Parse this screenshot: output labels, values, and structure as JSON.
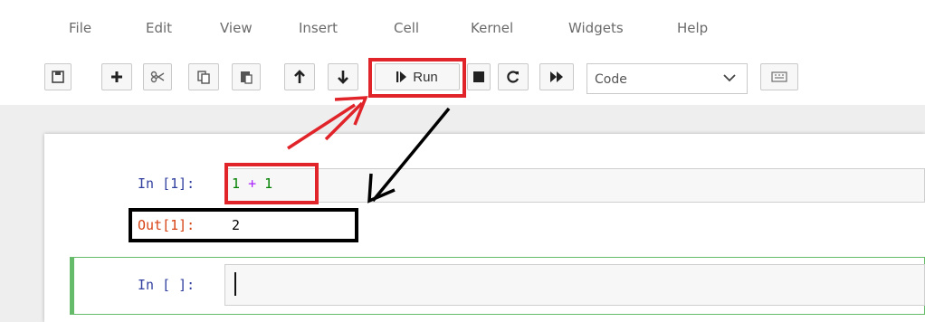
{
  "menu": [
    {
      "label": "File"
    },
    {
      "label": "Edit"
    },
    {
      "label": "View"
    },
    {
      "label": "Insert"
    },
    {
      "label": "Cell"
    },
    {
      "label": "Kernel"
    },
    {
      "label": "Widgets"
    },
    {
      "label": "Help"
    }
  ],
  "toolbar": {
    "run_label": "Run",
    "cell_type": "Code",
    "icons": [
      "save-icon",
      "plus-icon",
      "scissors-icon",
      "copy-icon",
      "paste-icon",
      "arrow-up-icon",
      "arrow-down-icon",
      "run-icon",
      "stop-icon",
      "restart-icon",
      "fast-forward-icon",
      "chevron-down-icon",
      "keyboard-icon"
    ]
  },
  "cells": {
    "cell1": {
      "in_prompt": "In [1]:",
      "code_a": "1",
      "code_op": "+",
      "code_b": "1",
      "out_prompt": "Out[1]:",
      "output": "2"
    },
    "cell2": {
      "in_prompt": "In [ ]:"
    }
  },
  "colors": {
    "annotation_red": "#e0242a",
    "annotation_black": "#000000",
    "selected_cell_border": "#66bb6a",
    "in_prompt": "#303f9f",
    "out_prompt": "#d84315",
    "number": "#008000",
    "operator": "#aa22ff"
  }
}
